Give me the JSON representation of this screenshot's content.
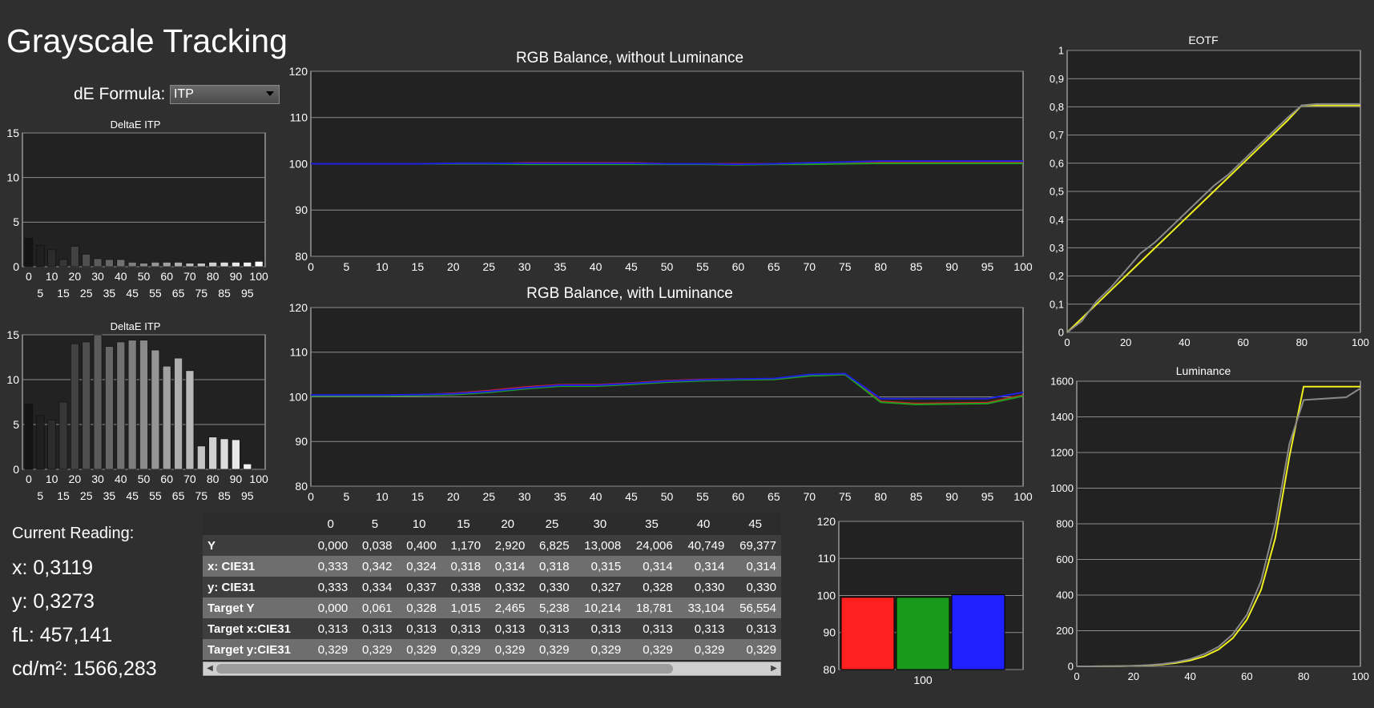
{
  "title": "Grayscale Tracking",
  "de_formula": {
    "label": "dE Formula:",
    "value": "ITP"
  },
  "charts": {
    "deltae_top": {
      "title": "DeltaE ITP"
    },
    "deltae_bottom": {
      "title": "DeltaE ITP"
    },
    "rgb_without": {
      "title": "RGB Balance, without Luminance"
    },
    "rgb_with": {
      "title": "RGB Balance, with Luminance"
    },
    "eotf": {
      "title": "EOTF"
    },
    "luminance": {
      "title": "Luminance"
    }
  },
  "current_reading": {
    "heading": "Current Reading:",
    "x": "x: 0,3119",
    "y": "y: 0,3273",
    "fl": "fL: 457,141",
    "cdm2": "cd/m²: 1566,283"
  },
  "table": {
    "columns": [
      "0",
      "5",
      "10",
      "15",
      "20",
      "25",
      "30",
      "35",
      "40",
      "45"
    ],
    "rows": [
      {
        "label": "Y",
        "values": [
          "0,000",
          "0,038",
          "0,400",
          "1,170",
          "2,920",
          "6,825",
          "13,008",
          "24,006",
          "40,749",
          "69,377"
        ]
      },
      {
        "label": "x: CIE31",
        "values": [
          "0,333",
          "0,342",
          "0,324",
          "0,318",
          "0,314",
          "0,318",
          "0,315",
          "0,314",
          "0,314",
          "0,314"
        ]
      },
      {
        "label": "y: CIE31",
        "values": [
          "0,333",
          "0,334",
          "0,337",
          "0,338",
          "0,332",
          "0,330",
          "0,327",
          "0,328",
          "0,330",
          "0,330"
        ]
      },
      {
        "label": "Target Y",
        "values": [
          "0,000",
          "0,061",
          "0,328",
          "1,015",
          "2,465",
          "5,238",
          "10,214",
          "18,781",
          "33,104",
          "56,554"
        ]
      },
      {
        "label": "Target x:CIE31",
        "values": [
          "0,313",
          "0,313",
          "0,313",
          "0,313",
          "0,313",
          "0,313",
          "0,313",
          "0,313",
          "0,313",
          "0,313"
        ]
      },
      {
        "label": "Target y:CIE31",
        "values": [
          "0,329",
          "0,329",
          "0,329",
          "0,329",
          "0,329",
          "0,329",
          "0,329",
          "0,329",
          "0,329",
          "0,329"
        ]
      }
    ]
  },
  "chart_data": [
    {
      "type": "bar",
      "title": "DeltaE ITP",
      "categories": [
        "0",
        "5",
        "10",
        "15",
        "20",
        "25",
        "30",
        "35",
        "40",
        "45",
        "50",
        "55",
        "60",
        "65",
        "70",
        "75",
        "80",
        "85",
        "90",
        "95",
        "100"
      ],
      "values": [
        3.2,
        2.4,
        1.9,
        0.8,
        2.3,
        1.4,
        0.9,
        0.8,
        0.8,
        0.5,
        0.4,
        0.5,
        0.5,
        0.5,
        0.4,
        0.4,
        0.5,
        0.5,
        0.5,
        0.5,
        0.6
      ],
      "ylim": [
        0,
        15
      ],
      "yticks": [
        "0",
        "5",
        "10",
        "15"
      ],
      "xticks_row1": [
        "0",
        "10",
        "20",
        "30",
        "40",
        "50",
        "60",
        "70",
        "80",
        "90",
        "100"
      ],
      "xticks_row2": [
        "5",
        "15",
        "25",
        "35",
        "45",
        "55",
        "65",
        "75",
        "85",
        "95"
      ]
    },
    {
      "type": "bar",
      "title": "DeltaE ITP",
      "categories": [
        "0",
        "5",
        "10",
        "15",
        "20",
        "25",
        "30",
        "35",
        "40",
        "45",
        "50",
        "55",
        "60",
        "65",
        "70",
        "75",
        "80",
        "85",
        "90",
        "95",
        "100"
      ],
      "values": [
        7.3,
        6.0,
        5.5,
        7.5,
        14.0,
        14.2,
        15.0,
        13.7,
        14.2,
        14.4,
        14.4,
        13.3,
        11.5,
        12.4,
        11.0,
        2.6,
        3.6,
        3.4,
        3.3,
        0.6,
        0.0
      ],
      "ylim": [
        0,
        15
      ],
      "yticks": [
        "0",
        "5",
        "10",
        "15"
      ],
      "xticks_row1": [
        "0",
        "10",
        "20",
        "30",
        "40",
        "50",
        "60",
        "70",
        "80",
        "90",
        "100"
      ],
      "xticks_row2": [
        "5",
        "15",
        "25",
        "35",
        "45",
        "55",
        "65",
        "75",
        "85",
        "95"
      ]
    },
    {
      "type": "line",
      "title": "RGB Balance, without Luminance",
      "x": [
        0,
        5,
        10,
        15,
        20,
        25,
        30,
        35,
        40,
        45,
        50,
        55,
        60,
        65,
        70,
        75,
        80,
        85,
        90,
        95,
        100
      ],
      "series": [
        {
          "color": "#d02020",
          "values": [
            100,
            100,
            100,
            100,
            100,
            100,
            100.2,
            100.2,
            100.2,
            100.2,
            100,
            100,
            100,
            100,
            100.2,
            100.3,
            100.3,
            100.3,
            100.3,
            100.3,
            100.4
          ]
        },
        {
          "color": "#20a020",
          "values": [
            100,
            100,
            100,
            100,
            100,
            100,
            99.9,
            99.9,
            99.9,
            99.9,
            99.9,
            99.9,
            99.8,
            99.9,
            99.9,
            100,
            100.1,
            100.1,
            100.1,
            100.1,
            100.1
          ]
        },
        {
          "color": "#2020e0",
          "values": [
            100,
            100,
            100,
            100,
            100.1,
            100.1,
            100.1,
            100.1,
            100.1,
            100.1,
            100,
            100,
            99.9,
            100,
            100.2,
            100.4,
            100.6,
            100.6,
            100.6,
            100.6,
            100.6
          ]
        }
      ],
      "ylim": [
        80,
        120
      ],
      "yticks": [
        "80",
        "90",
        "100",
        "110",
        "120"
      ],
      "xticks": [
        "0",
        "5",
        "10",
        "15",
        "20",
        "25",
        "30",
        "35",
        "40",
        "45",
        "50",
        "55",
        "60",
        "65",
        "70",
        "75",
        "80",
        "85",
        "90",
        "95",
        "100"
      ]
    },
    {
      "type": "line",
      "title": "RGB Balance, with Luminance",
      "x": [
        0,
        5,
        10,
        15,
        20,
        25,
        30,
        35,
        40,
        45,
        50,
        55,
        60,
        65,
        70,
        75,
        80,
        85,
        90,
        95,
        100
      ],
      "series": [
        {
          "color": "#d02020",
          "values": [
            100.3,
            100.3,
            100.3,
            100.4,
            100.8,
            101.4,
            102.2,
            102.7,
            102.7,
            103.1,
            103.6,
            103.9,
            104.0,
            104.0,
            104.9,
            105.1,
            99.0,
            98.5,
            98.6,
            98.7,
            100.4
          ]
        },
        {
          "color": "#20a020",
          "values": [
            100.2,
            100.2,
            100.2,
            100.3,
            100.5,
            101.0,
            101.8,
            102.4,
            102.4,
            102.8,
            103.3,
            103.6,
            103.8,
            103.9,
            104.7,
            105.0,
            98.8,
            98.3,
            98.4,
            98.5,
            100.2
          ]
        },
        {
          "color": "#2020e0",
          "values": [
            100.4,
            100.4,
            100.4,
            100.5,
            100.7,
            101.2,
            102.0,
            102.6,
            102.6,
            103.0,
            103.5,
            103.8,
            104.0,
            104.1,
            105.0,
            105.2,
            99.6,
            99.6,
            99.6,
            99.6,
            101.0
          ]
        }
      ],
      "ylim": [
        80,
        120
      ],
      "yticks": [
        "80",
        "90",
        "100",
        "110",
        "120"
      ],
      "xticks": [
        "0",
        "5",
        "10",
        "15",
        "20",
        "25",
        "30",
        "35",
        "40",
        "45",
        "50",
        "55",
        "60",
        "65",
        "70",
        "75",
        "80",
        "85",
        "90",
        "95",
        "100"
      ]
    },
    {
      "type": "line",
      "title": "EOTF",
      "x": [
        0,
        5,
        10,
        15,
        20,
        25,
        30,
        35,
        40,
        45,
        50,
        55,
        60,
        65,
        70,
        75,
        80,
        85,
        90,
        95,
        100
      ],
      "series": [
        {
          "color": "#f0f020",
          "values": [
            0,
            0.05,
            0.1,
            0.15,
            0.2,
            0.25,
            0.3,
            0.35,
            0.4,
            0.45,
            0.5,
            0.55,
            0.6,
            0.65,
            0.7,
            0.75,
            0.805,
            0.805,
            0.805,
            0.805,
            0.805
          ]
        },
        {
          "color": "#8a8a8a",
          "values": [
            0,
            0.04,
            0.11,
            0.16,
            0.22,
            0.28,
            0.32,
            0.37,
            0.42,
            0.47,
            0.52,
            0.56,
            0.61,
            0.66,
            0.71,
            0.76,
            0.805,
            0.81,
            0.81,
            0.81,
            0.81
          ]
        }
      ],
      "ylim": [
        0,
        1
      ],
      "yticks": [
        "0",
        "0,1",
        "0,2",
        "0,3",
        "0,4",
        "0,5",
        "0,6",
        "0,7",
        "0,8",
        "0,9",
        "1"
      ],
      "xticks": [
        "0",
        "20",
        "40",
        "60",
        "80",
        "100"
      ]
    },
    {
      "type": "line",
      "title": "Luminance",
      "x": [
        0,
        5,
        10,
        15,
        20,
        25,
        30,
        35,
        40,
        45,
        50,
        55,
        60,
        65,
        70,
        75,
        80,
        85,
        90,
        95,
        100
      ],
      "series": [
        {
          "color": "#f0f020",
          "values": [
            0,
            0.1,
            0.4,
            1,
            2.5,
            5.2,
            10.2,
            18.8,
            33.1,
            56.6,
            95,
            158,
            262,
            430,
            720,
            1180,
            1570,
            1570,
            1570,
            1570,
            1570
          ]
        },
        {
          "color": "#8a8a8a",
          "values": [
            0,
            0.04,
            0.4,
            1.2,
            2.9,
            6.8,
            13,
            24,
            40.7,
            69.4,
            110,
            180,
            290,
            480,
            800,
            1250,
            1495,
            1500,
            1505,
            1510,
            1560
          ]
        }
      ],
      "ylim": [
        0,
        1600
      ],
      "yticks": [
        "0",
        "200",
        "400",
        "600",
        "800",
        "1000",
        "1200",
        "1400",
        "1600"
      ],
      "xticks": [
        "0",
        "20",
        "40",
        "60",
        "80",
        "100"
      ]
    },
    {
      "type": "bar",
      "title": "",
      "categories": [
        "100"
      ],
      "series": [
        {
          "color": "#ff2020",
          "values": [
            99.5
          ]
        },
        {
          "color": "#1a9a1a",
          "values": [
            99.5
          ]
        },
        {
          "color": "#2020ff",
          "values": [
            100.2
          ]
        }
      ],
      "ylim": [
        80,
        120
      ],
      "yticks": [
        "80",
        "90",
        "100",
        "110",
        "120"
      ]
    }
  ]
}
